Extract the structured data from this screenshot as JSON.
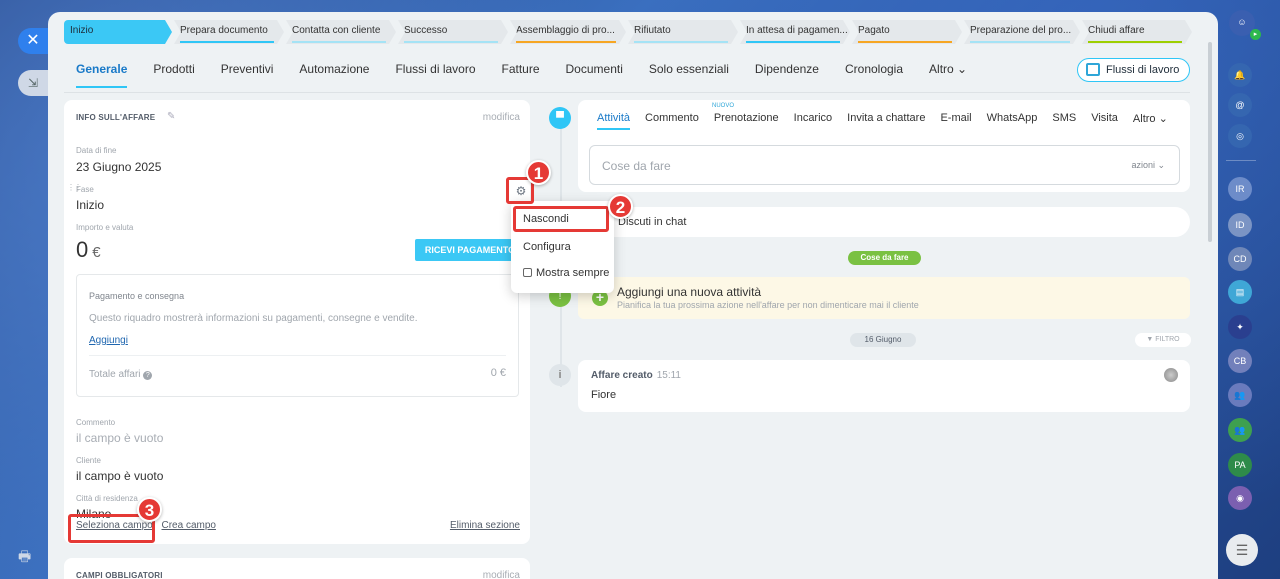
{
  "stages": [
    {
      "label": "Inizio",
      "color": "#3bc8f5",
      "active": true
    },
    {
      "label": "Prepara documento",
      "color": "#2fc6f6"
    },
    {
      "label": "Contatta con cliente",
      "color": "#a5e3f5"
    },
    {
      "label": "Successo",
      "color": "#a5e3f5"
    },
    {
      "label": "Assemblaggio di pro...",
      "color": "#f6a623"
    },
    {
      "label": "Rifiutato",
      "color": "#a5e3f5"
    },
    {
      "label": "In attesa di pagamen...",
      "color": "#2fc6f6"
    },
    {
      "label": "Pagato",
      "color": "#f6a623"
    },
    {
      "label": "Preparazione del pro...",
      "color": "#a5e3f5"
    },
    {
      "label": "Chiudi affare",
      "color": "#9dcf00"
    }
  ],
  "tabs": [
    "Generale",
    "Prodotti",
    "Preventivi",
    "Automazione",
    "Flussi di lavoro",
    "Fatture",
    "Documenti",
    "Solo essenziali",
    "Dipendenze",
    "Cronologia",
    "Altro ⌄"
  ],
  "flows_button": "Flussi di lavoro",
  "info": {
    "section_title": "INFO SULL'AFFARE",
    "edit": "modifica",
    "end_date_label": "Data di fine",
    "end_date": "23 Giugno 2025",
    "phase_label": "Fase",
    "phase": "Inizio",
    "amount_label": "Importo e valuta",
    "amount": "0",
    "currency": "€",
    "pay_button": "RICEVI PAGAMENTO",
    "payment_title": "Pagamento e consegna",
    "payment_desc": "Questo riquadro mostrerà informazioni su pagamenti, consegne e vendite.",
    "add": "Aggiungi",
    "total_label": "Totale affari",
    "total_value": "0 €",
    "comment_label": "Commento",
    "comment_value": "il campo è vuoto",
    "client_label": "Cliente",
    "client_value": "il campo è vuoto",
    "city_label": "Città di residenza",
    "city_value": "Milano",
    "select_field": "Seleziona campo",
    "create_field": "Crea campo",
    "delete_section": "Elimina sezione"
  },
  "required": {
    "title": "CAMPI OBBLIGATORI",
    "edit": "modifica"
  },
  "context_menu": {
    "hide": "Nascondi",
    "configure": "Configura",
    "show_always": "Mostra sempre"
  },
  "callouts": [
    "1",
    "2",
    "3"
  ],
  "activity": {
    "tabs": [
      "Attività",
      "Commento",
      "Prenotazione",
      "Incarico",
      "Invita a chattare",
      "E-mail",
      "WhatsApp",
      "SMS",
      "Visita",
      "Altro ⌄"
    ],
    "new_badge": "NUOVO",
    "todo_placeholder": "Cose da fare",
    "actions": "azioni ⌄",
    "chat": "Discuti in chat",
    "todo_pill": "Cose da fare",
    "new_activity_title": "Aggiungi una nuova attività",
    "new_activity_sub": "Pianifica la tua prossima azione nell'affare per non dimenticare mai il cliente",
    "date_pill": "16 Giugno",
    "filter": "FILTRO",
    "created_title": "Affare creato",
    "created_time": "15:11",
    "created_value": "Fiore"
  },
  "right_rail": [
    "IR",
    "ID",
    "CD",
    "CB",
    "PA"
  ]
}
